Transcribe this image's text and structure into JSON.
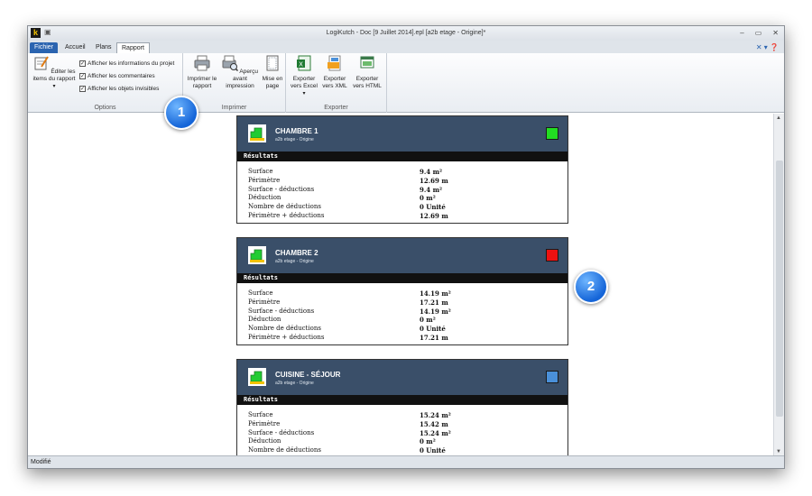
{
  "window": {
    "title": "LogiKutch - Doc [9 Juillet 2014].epl [a2b etage - Origine]*",
    "minimize": "–",
    "maximize": "▭",
    "close": "✕"
  },
  "app_logo": "k",
  "tabs": {
    "file": "Fichier",
    "home": "Accueil",
    "plans": "Plans",
    "report": "Rapport"
  },
  "ribbon": {
    "options": {
      "edit_items": "Éditer les items du rapport",
      "check_project_info": "Afficher les informations du projet",
      "check_comments": "Afficher les commentaires",
      "check_hidden": "Afficher les objets invisibles",
      "label": "Options"
    },
    "print": {
      "print_report": "Imprimer le rapport",
      "preview": "Aperçu avant impression",
      "page_setup": "Mise en page",
      "label": "Imprimer"
    },
    "export": {
      "excel": "Exporter vers Excel",
      "xml": "Exporter vers XML",
      "html": "Exporter vers HTML",
      "label": "Exporter"
    }
  },
  "rooms": [
    {
      "name": "CHAMBRE 1",
      "subtitle": "a2b etage - Origine",
      "color": "#22dd22",
      "results_label": "Résultats",
      "rows": [
        {
          "label": "Surface",
          "value": "9.4 m²"
        },
        {
          "label": "Périmètre",
          "value": "12.69 m"
        },
        {
          "label": "Surface - déductions",
          "value": "9.4 m²"
        },
        {
          "label": "Déduction",
          "value": "0 m²"
        },
        {
          "label": "Nombre de déductions",
          "value": "0 Unité"
        },
        {
          "label": "Périmètre + déductions",
          "value": "12.69 m"
        }
      ]
    },
    {
      "name": "CHAMBRE 2",
      "subtitle": "a2b etage - Origine",
      "color": "#ee1111",
      "results_label": "Résultats",
      "rows": [
        {
          "label": "Surface",
          "value": "14.19 m²"
        },
        {
          "label": "Périmètre",
          "value": "17.21 m"
        },
        {
          "label": "Surface - déductions",
          "value": "14.19 m²"
        },
        {
          "label": "Déduction",
          "value": "0 m²"
        },
        {
          "label": "Nombre de déductions",
          "value": "0 Unité"
        },
        {
          "label": "Périmètre + déductions",
          "value": "17.21 m"
        }
      ]
    },
    {
      "name": "CUISINE - SÉJOUR",
      "subtitle": "a2b etage - Origine",
      "color": "#4a90d9",
      "results_label": "Résultats",
      "rows": [
        {
          "label": "Surface",
          "value": "15.24 m²"
        },
        {
          "label": "Périmètre",
          "value": "15.42 m"
        },
        {
          "label": "Surface - déductions",
          "value": "15.24 m²"
        },
        {
          "label": "Déduction",
          "value": "0 m²"
        },
        {
          "label": "Nombre de déductions",
          "value": "0 Unité"
        }
      ]
    }
  ],
  "callouts": [
    "1",
    "2"
  ],
  "status": "Modifié"
}
